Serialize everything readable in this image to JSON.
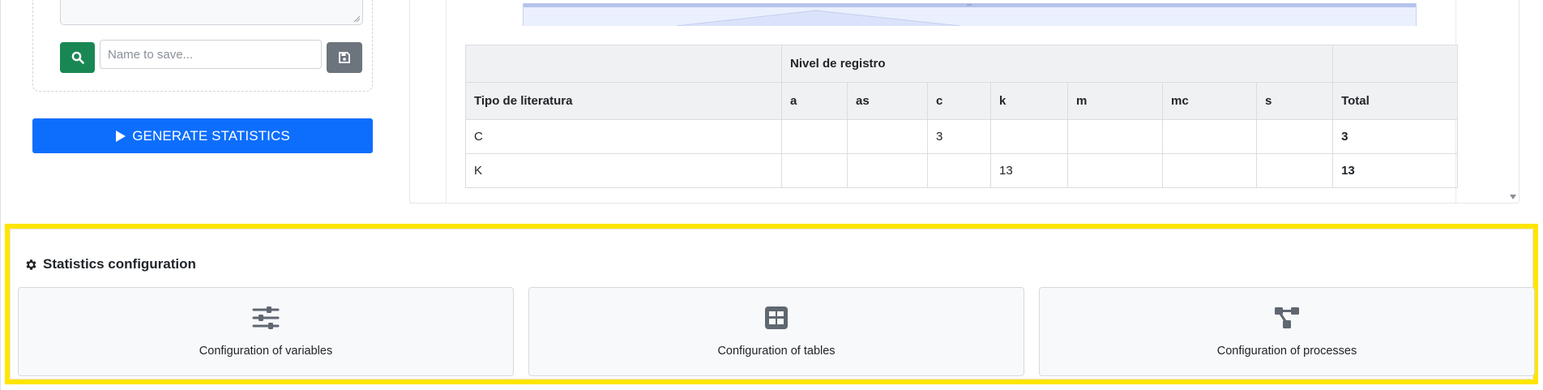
{
  "left": {
    "search_icon": "search-icon",
    "save_input_placeholder": "Name to save...",
    "save_icon": "floppy-disk-icon",
    "generate_label": "GENERATE STATISTICS",
    "generate_icon": "play-icon"
  },
  "table": {
    "group_header": "Nivel de registro",
    "columns": [
      "Tipo de literatura",
      "a",
      "as",
      "c",
      "k",
      "m",
      "mc",
      "s",
      "Total"
    ],
    "rows": [
      {
        "tipo": "C",
        "a": "",
        "as": "",
        "c": "3",
        "k": "",
        "m": "",
        "mc": "",
        "s": "",
        "total": "3"
      },
      {
        "tipo": "K",
        "a": "",
        "as": "",
        "c": "",
        "k": "13",
        "m": "",
        "mc": "",
        "s": "",
        "total": "13"
      }
    ]
  },
  "config": {
    "title": "Statistics configuration",
    "title_icon": "gear-icon",
    "cards": [
      {
        "label": "Configuration of variables",
        "icon": "sliders-icon"
      },
      {
        "label": "Configuration of tables",
        "icon": "table-grid-icon"
      },
      {
        "label": "Configuration of processes",
        "icon": "process-diagram-icon"
      }
    ]
  },
  "colors": {
    "success": "#198754",
    "secondary": "#6c757d",
    "primary": "#0d6efd",
    "highlight": "#ffe500",
    "icon_gray": "#5f6771"
  }
}
